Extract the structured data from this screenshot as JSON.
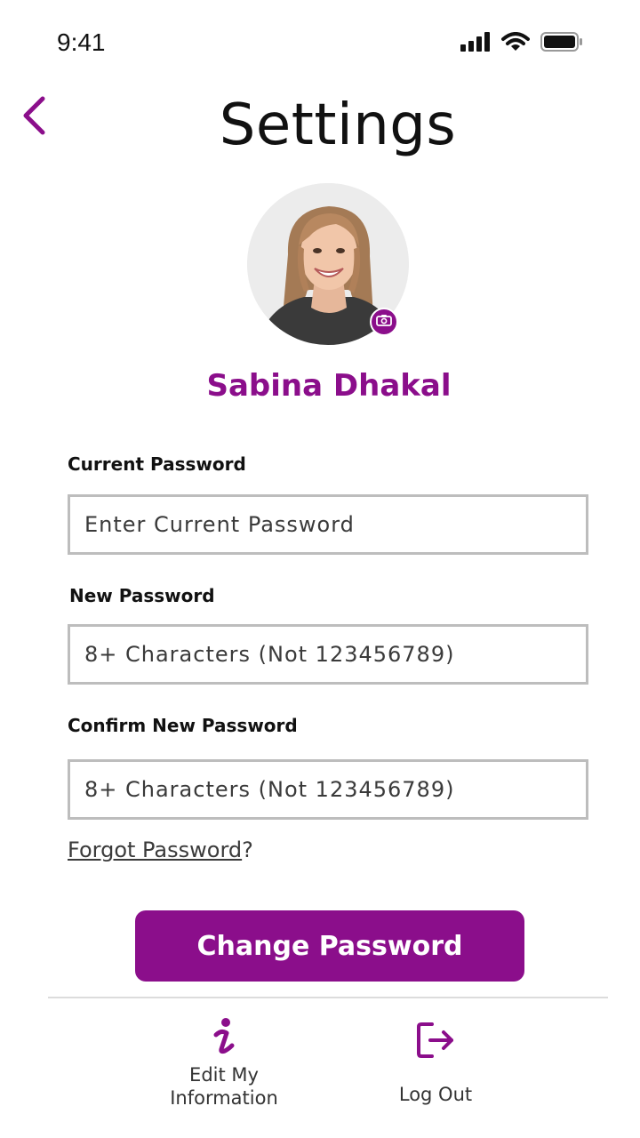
{
  "status_bar": {
    "time": "9:41"
  },
  "header": {
    "title": "Settings",
    "back_icon": "chevron-left-icon"
  },
  "profile": {
    "name": "Sabina Dhakal",
    "camera_icon": "camera-icon"
  },
  "form": {
    "current_password": {
      "label": "Current Password",
      "placeholder": "Enter Current Password",
      "value": ""
    },
    "new_password": {
      "label": "New Password",
      "placeholder": "8+ Characters (Not 123456789)",
      "value": ""
    },
    "confirm_password": {
      "label": "Confirm New Password",
      "placeholder": "8+ Characters (Not 123456789)",
      "value": ""
    },
    "forgot_link": "Forgot Password",
    "forgot_suffix": "?",
    "submit_label": "Change Password"
  },
  "bottom_nav": {
    "items": [
      {
        "label_line1": "Edit My",
        "label_line2": "Information",
        "icon": "info-icon"
      },
      {
        "label": "Log Out",
        "icon": "logout-icon"
      }
    ]
  },
  "colors": {
    "accent": "#8b0e8b",
    "input_border": "#bdbdbd",
    "divider": "#dcdcdc"
  }
}
